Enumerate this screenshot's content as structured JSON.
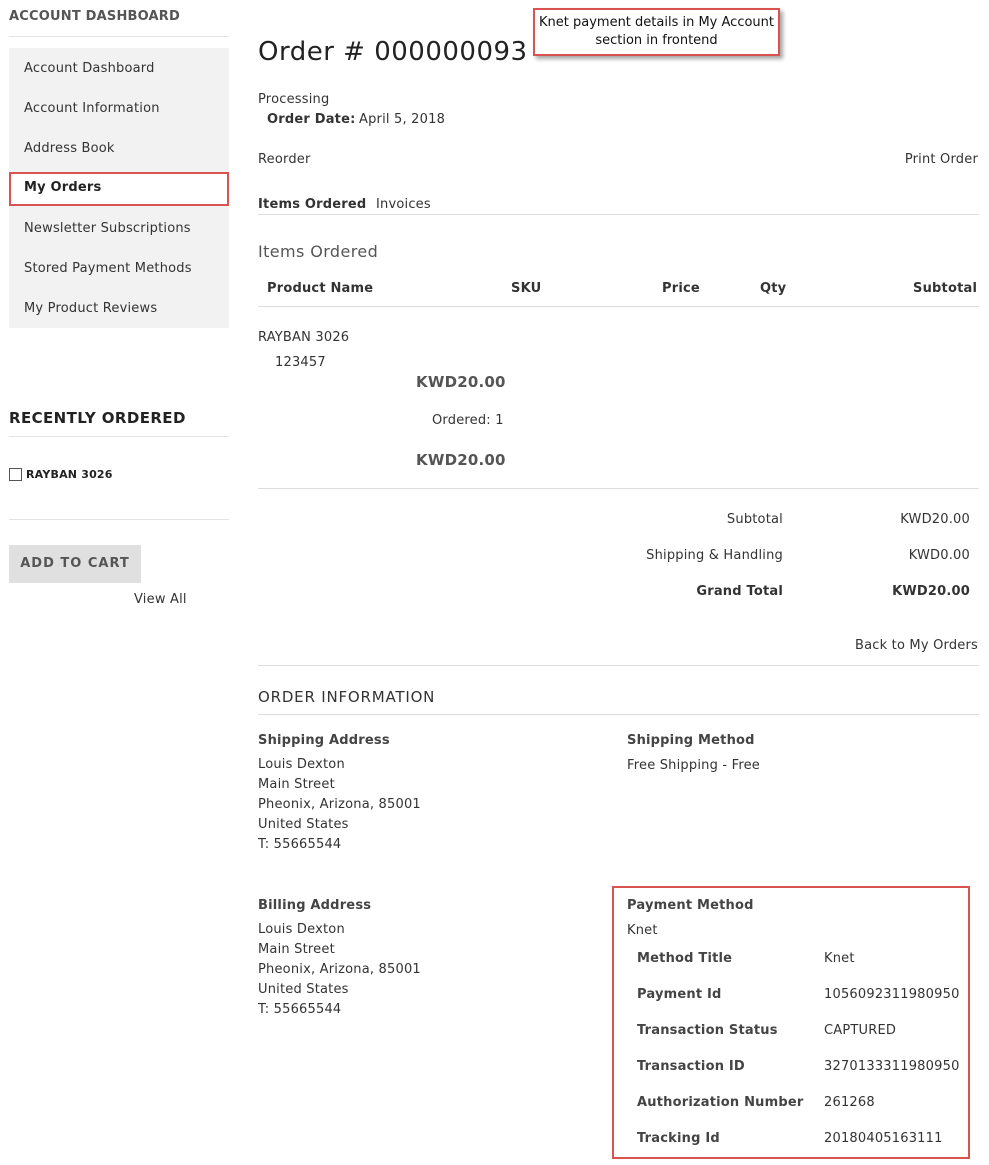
{
  "sidebar": {
    "title": "ACCOUNT DASHBOARD",
    "items": [
      {
        "label": "Account Dashboard"
      },
      {
        "label": "Account Information"
      },
      {
        "label": "Address Book"
      },
      {
        "label": "My Orders"
      },
      {
        "label": "Newsletter Subscriptions"
      },
      {
        "label": "Stored Payment Methods"
      },
      {
        "label": "My Product Reviews"
      }
    ],
    "recent_title": "RECENTLY ORDERED",
    "recent_item": "RAYBAN 3026",
    "add_to_cart": "ADD TO CART",
    "view_all": "View All"
  },
  "callout": {
    "line1": "Knet payment details in My Account",
    "line2": "section in frontend"
  },
  "order": {
    "title": "Order # 000000093",
    "status": "Processing",
    "date_label": "Order Date:",
    "date_value": "April 5, 2018",
    "reorder": "Reorder",
    "print": "Print Order",
    "tabs": [
      {
        "label": "Items Ordered"
      },
      {
        "label": "Invoices"
      }
    ],
    "items_title": "Items Ordered",
    "columns": [
      "Product Name",
      "SKU",
      "Price",
      "Qty",
      "Subtotal"
    ],
    "item": {
      "name": "RAYBAN 3026",
      "sku": "123457",
      "price": "KWD20.00",
      "qty": "Ordered: 1",
      "subtotal": "KWD20.00"
    },
    "totals": [
      {
        "label": "Subtotal",
        "value": "KWD20.00"
      },
      {
        "label": "Shipping & Handling",
        "value": "KWD0.00"
      },
      {
        "label": "Grand Total",
        "value": "KWD20.00"
      }
    ],
    "back": "Back to My Orders"
  },
  "info": {
    "title": "ORDER INFORMATION",
    "shipping_address_title": "Shipping Address",
    "shipping_address": [
      "Louis Dexton",
      "Main Street",
      "Pheonix, Arizona, 85001",
      "United States",
      "T: 55665544"
    ],
    "shipping_method_title": "Shipping Method",
    "shipping_method": "Free Shipping - Free",
    "billing_address_title": "Billing Address",
    "billing_address": [
      "Louis Dexton",
      "Main Street",
      "Pheonix, Arizona, 85001",
      "United States",
      "T: 55665544"
    ],
    "payment_method_title": "Payment Method",
    "payment_method": "Knet",
    "payment_rows": [
      {
        "label": "Method Title",
        "value": "Knet"
      },
      {
        "label": "Payment Id",
        "value": "1056092311980950"
      },
      {
        "label": "Transaction Status",
        "value": "CAPTURED"
      },
      {
        "label": "Transaction ID",
        "value": "3270133311980950"
      },
      {
        "label": "Authorization Number",
        "value": "261268"
      },
      {
        "label": "Tracking Id",
        "value": "20180405163111"
      }
    ]
  },
  "colors": {
    "highlight": "#d9534f",
    "sidebar_bg": "#f2f2f2",
    "button_bg": "#e0e0e0"
  }
}
